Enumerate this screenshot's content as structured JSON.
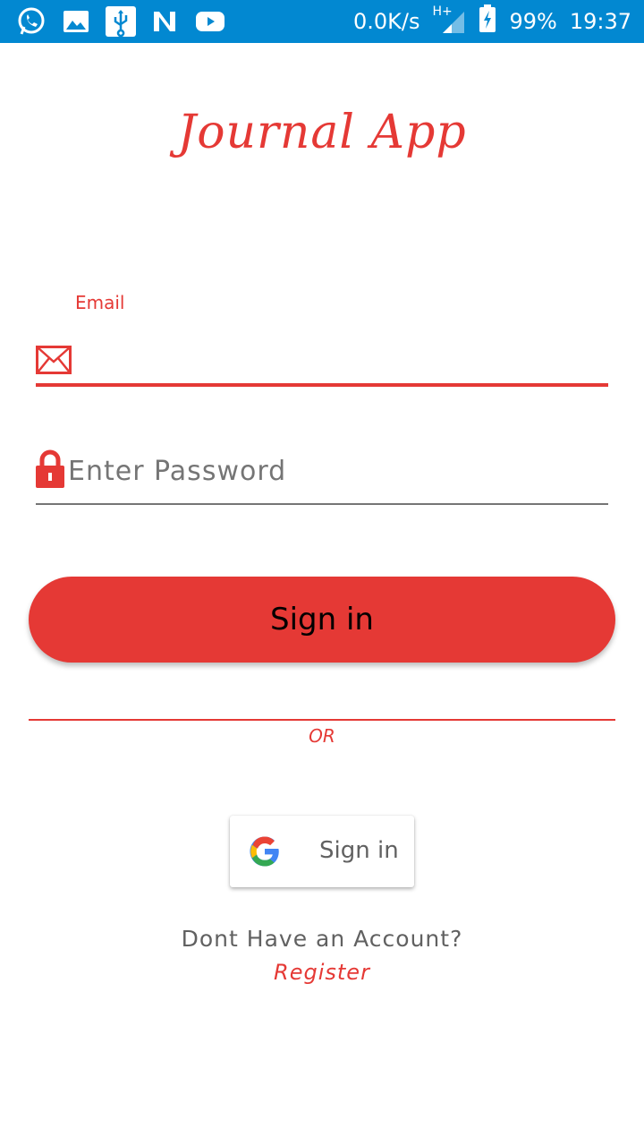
{
  "status_bar": {
    "icons": [
      "whatsapp-icon",
      "gallery-icon",
      "usb-icon",
      "n-app-icon",
      "youtube-icon"
    ],
    "net_speed": "0.0K/s",
    "network": "H+",
    "battery": "99%",
    "time": "19:37",
    "background": "#0288d1"
  },
  "app": {
    "title": "Journal App"
  },
  "form": {
    "email_label": "Email",
    "email_value": "",
    "password_placeholder": "Enter Password",
    "sign_in_label": "Sign in",
    "or_label": "OR",
    "google_sign_in_label": "Sign in",
    "no_account_text": "Dont Have an Account?",
    "register_label": "Register"
  },
  "colors": {
    "accent": "#e53935",
    "text_muted": "#616161",
    "placeholder": "#9e9e9e"
  }
}
